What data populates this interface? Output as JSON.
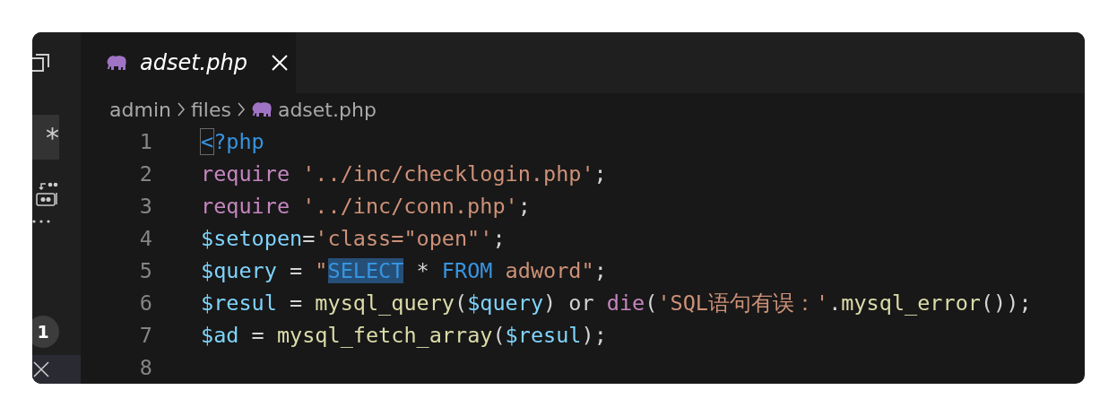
{
  "sidebar": {
    "regex_toggle": "*",
    "badge": "1"
  },
  "tab": {
    "title": "adset.php",
    "selected": true
  },
  "breadcrumb": [
    "admin",
    "files",
    "adset.php"
  ],
  "lines": [
    {
      "number": "1",
      "tokens": [
        {
          "text": "<",
          "kind": "tag",
          "cursor": true
        },
        {
          "text": "?php",
          "kind": "tag"
        }
      ]
    },
    {
      "number": "2",
      "tokens": [
        {
          "text": "require ",
          "kind": "keyword"
        },
        {
          "text": "'../inc/checklogin.php'",
          "kind": "string"
        },
        {
          "text": ";",
          "kind": "plain"
        }
      ]
    },
    {
      "number": "3",
      "tokens": [
        {
          "text": "require ",
          "kind": "keyword"
        },
        {
          "text": "'../inc/conn.php'",
          "kind": "string"
        },
        {
          "text": ";",
          "kind": "plain"
        }
      ]
    },
    {
      "number": "4",
      "tokens": [
        {
          "text": "$setopen",
          "kind": "variable"
        },
        {
          "text": "=",
          "kind": "plain"
        },
        {
          "text": "'class=\"open\"'",
          "kind": "string"
        },
        {
          "text": ";",
          "kind": "plain"
        }
      ]
    },
    {
      "number": "5",
      "tokens": [
        {
          "text": "$query",
          "kind": "variable"
        },
        {
          "text": " = ",
          "kind": "plain"
        },
        {
          "text": "\"",
          "kind": "string"
        },
        {
          "text": "SELECT",
          "kind": "sql",
          "highlighted": true
        },
        {
          "text": " * ",
          "kind": "plain"
        },
        {
          "text": "FROM",
          "kind": "sql"
        },
        {
          "text": " adword\"",
          "kind": "string"
        },
        {
          "text": ";",
          "kind": "plain"
        }
      ]
    },
    {
      "number": "6",
      "tokens": [
        {
          "text": "$resul",
          "kind": "variable"
        },
        {
          "text": " = ",
          "kind": "plain"
        },
        {
          "text": "mysql_query",
          "kind": "function"
        },
        {
          "text": "(",
          "kind": "plain"
        },
        {
          "text": "$query",
          "kind": "variable"
        },
        {
          "text": ") or ",
          "kind": "plain"
        },
        {
          "text": "die",
          "kind": "keyword"
        },
        {
          "text": "(",
          "kind": "plain"
        },
        {
          "text": "'SQL语句有误：'",
          "kind": "string"
        },
        {
          "text": ".",
          "kind": "plain"
        },
        {
          "text": "mysql_error",
          "kind": "function"
        },
        {
          "text": "());",
          "kind": "plain"
        }
      ]
    },
    {
      "number": "7",
      "tokens": [
        {
          "text": "$ad",
          "kind": "variable"
        },
        {
          "text": " = ",
          "kind": "plain"
        },
        {
          "text": "mysql_fetch_array",
          "kind": "function"
        },
        {
          "text": "(",
          "kind": "plain"
        },
        {
          "text": "$resul",
          "kind": "variable"
        },
        {
          "text": ");",
          "kind": "plain"
        }
      ]
    },
    {
      "number": "8"
    }
  ]
}
